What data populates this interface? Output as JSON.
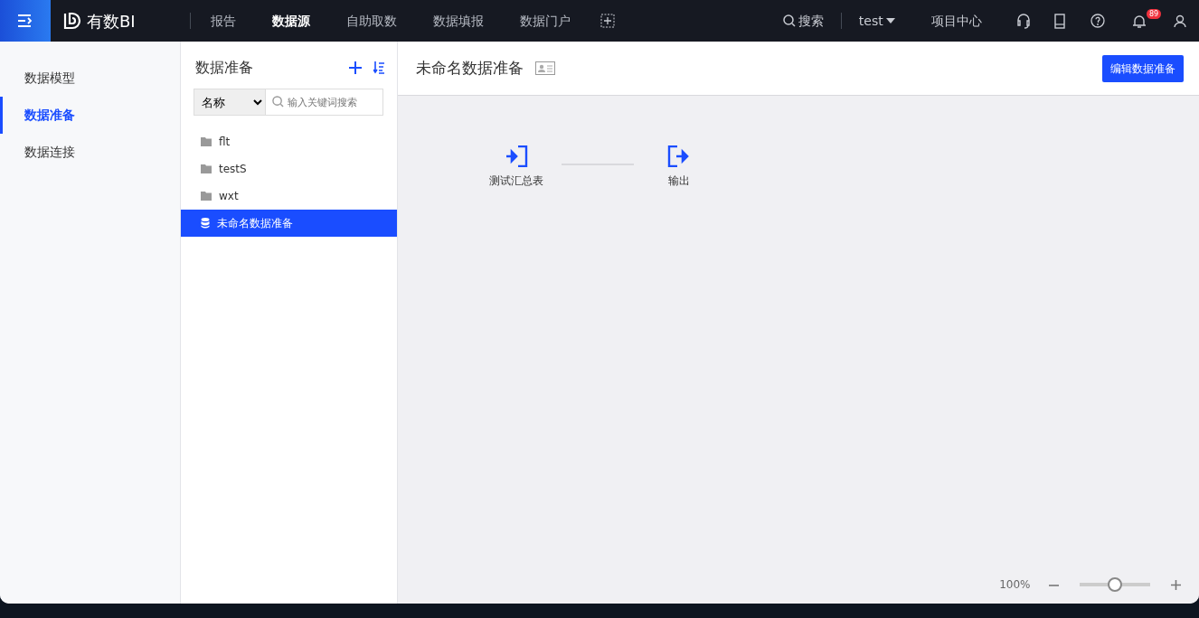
{
  "topbar": {
    "logo": "有数BI",
    "nav": [
      {
        "label": "报告",
        "selected": false
      },
      {
        "label": "数据源",
        "selected": true
      },
      {
        "label": "自助取数",
        "selected": false
      },
      {
        "label": "数据填报",
        "selected": false
      },
      {
        "label": "数据门户",
        "selected": false
      }
    ],
    "search": "搜索",
    "user": "test",
    "project_center": "项目中心",
    "notification_count": "89"
  },
  "sidebar": {
    "items": [
      {
        "label": "数据模型",
        "selected": false
      },
      {
        "label": "数据准备",
        "selected": true
      },
      {
        "label": "数据连接",
        "selected": false
      }
    ]
  },
  "panel": {
    "title": "数据准备",
    "filter": "名称",
    "search": {
      "placeholder": "输入关键词搜索"
    },
    "tree": [
      {
        "kind": "folder",
        "label": "flt",
        "selected": false
      },
      {
        "kind": "folder",
        "label": "testS",
        "selected": false
      },
      {
        "kind": "folder",
        "label": "wxt",
        "selected": false
      },
      {
        "kind": "dataset",
        "label": "未命名数据准备",
        "selected": true
      }
    ]
  },
  "main": {
    "title": "未命名数据准备",
    "edit_button": "编辑数据准备",
    "nodes": [
      {
        "kind": "input",
        "label": "测试汇总表"
      },
      {
        "kind": "output",
        "label": "输出"
      }
    ],
    "zoom": {
      "reading": "100%",
      "level": 0.5
    }
  }
}
